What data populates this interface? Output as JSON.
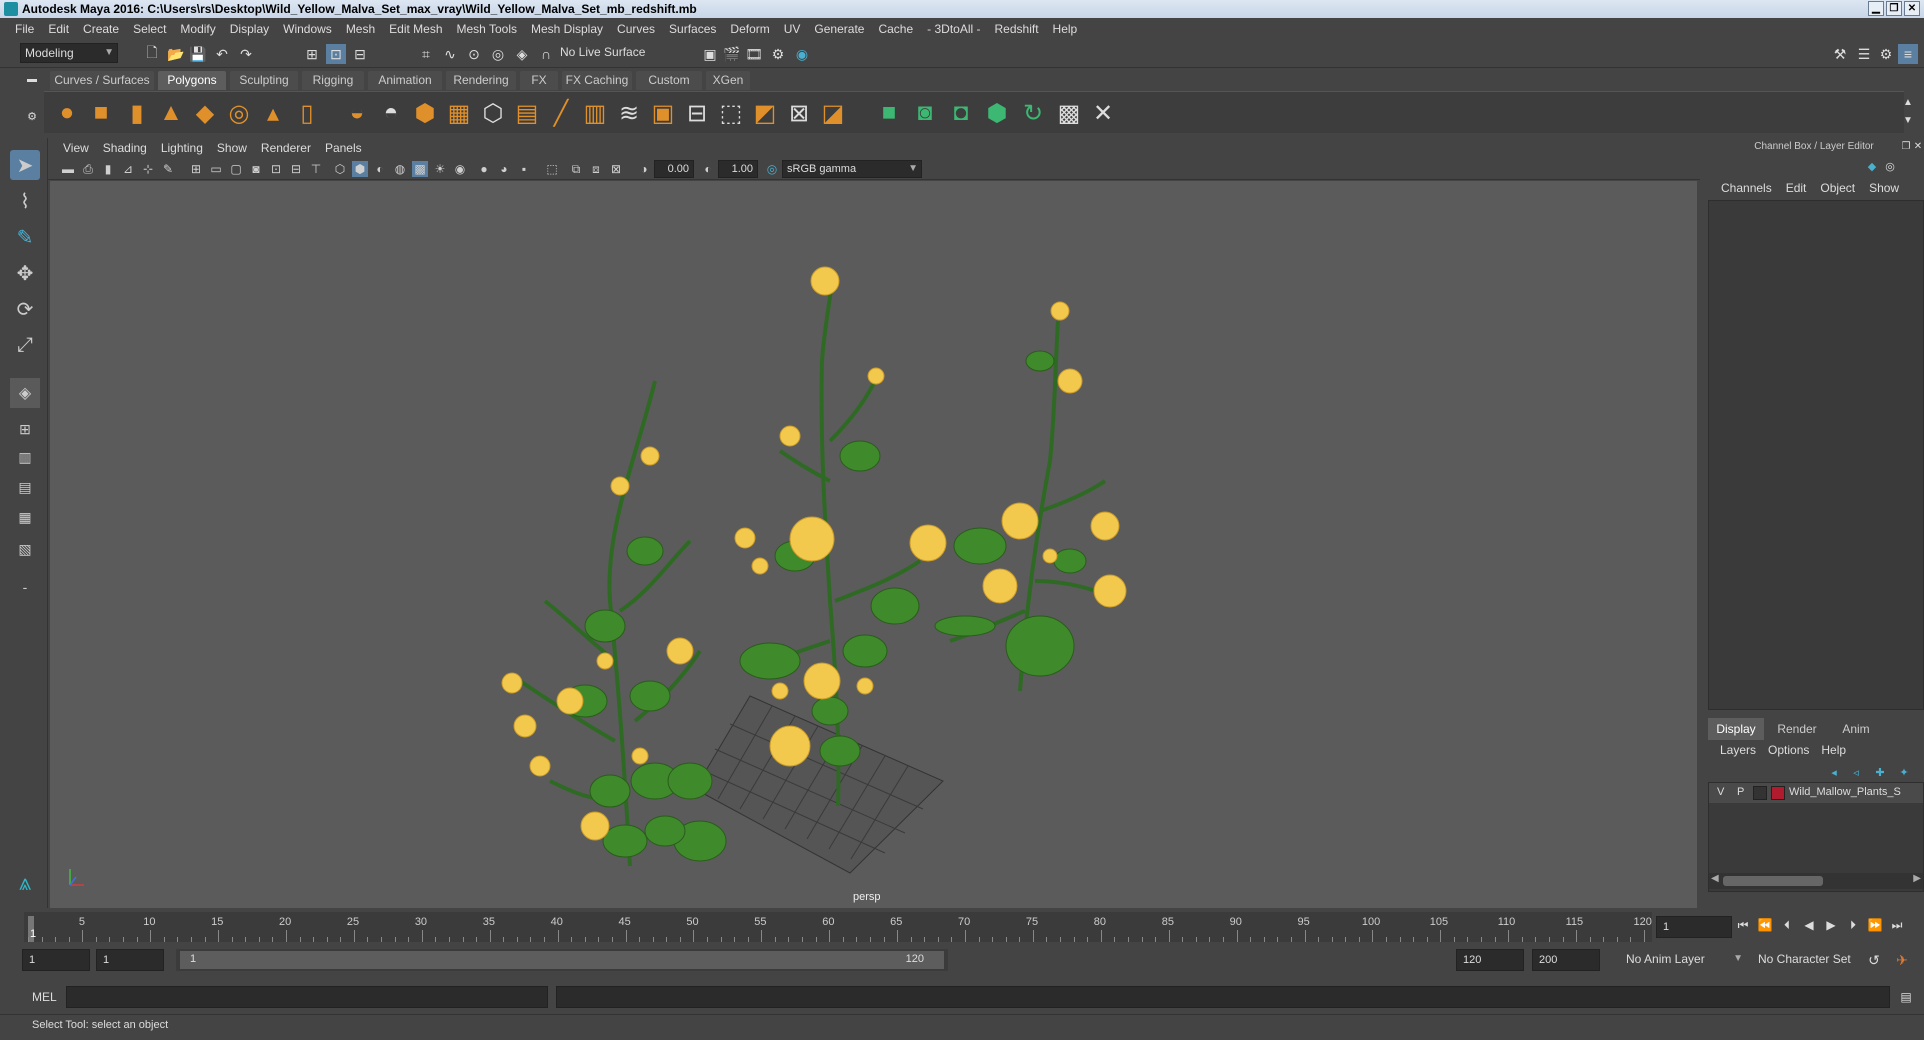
{
  "title": "Autodesk Maya 2016: C:\\Users\\rs\\Desktop\\Wild_Yellow_Malva_Set_max_vray\\Wild_Yellow_Malva_Set_mb_redshift.mb",
  "menu": [
    "File",
    "Edit",
    "Create",
    "Select",
    "Modify",
    "Display",
    "Windows",
    "Mesh",
    "Edit Mesh",
    "Mesh Tools",
    "Mesh Display",
    "Curves",
    "Surfaces",
    "Deform",
    "UV",
    "Generate",
    "Cache",
    "- 3DtoAll -",
    "Redshift",
    "Help"
  ],
  "mode_select": "Modeling",
  "live_surface": "No Live Surface",
  "shelf_tabs": [
    "Curves / Surfaces",
    "Polygons",
    "Sculpting",
    "Rigging",
    "Animation",
    "Rendering",
    "FX",
    "FX Caching",
    "Custom",
    "XGen"
  ],
  "active_shelf_tab": "Polygons",
  "viewport_menu": [
    "View",
    "Shading",
    "Lighting",
    "Show",
    "Renderer",
    "Panels"
  ],
  "exposure": "0.00",
  "gamma": "1.00",
  "color_space": "sRGB gamma",
  "camera_label": "persp",
  "right_panel": {
    "header": "Channel Box / Layer Editor",
    "menu": [
      "Channels",
      "Edit",
      "Object",
      "Show"
    ],
    "tabs": [
      "Display",
      "Render",
      "Anim"
    ],
    "active_tab": "Display",
    "submenu": [
      "Layers",
      "Options",
      "Help"
    ],
    "layer": {
      "v": "V",
      "p": "P",
      "name": "Wild_Mallow_Plants_S",
      "color": "#b01c2e"
    }
  },
  "timeline_ticks": [
    "5",
    "10",
    "15",
    "20",
    "25",
    "30",
    "35",
    "40",
    "45",
    "50",
    "55",
    "60",
    "65",
    "70",
    "75",
    "80",
    "85",
    "90",
    "95",
    "100",
    "105",
    "110",
    "115",
    "120"
  ],
  "current_frame_marker": "1",
  "current_frame": "1",
  "range": {
    "start": "1",
    "start2": "1",
    "slider_start": "1",
    "slider_end": "120",
    "end": "120",
    "end2": "200"
  },
  "anim_layer": "No Anim Layer",
  "character_set": "No Character Set",
  "mel_label": "MEL",
  "help_text": "Select Tool: select an object"
}
